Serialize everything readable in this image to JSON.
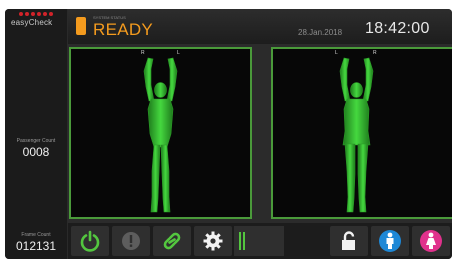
{
  "app": {
    "logo_text": "easyCheck",
    "status_small": "SYSTEM STATUS",
    "status": "READY",
    "date": "28.Jan.2018",
    "time": "18:42:00"
  },
  "counters": {
    "passenger_label": "Passenger Count",
    "passenger_value": "0008",
    "frame_label": "Frame Count",
    "frame_value": "012131"
  },
  "scans": {
    "front": {
      "marker_left": "R",
      "marker_right": "L"
    },
    "back": {
      "marker_left": "L",
      "marker_right": "R"
    }
  },
  "toolbar": {
    "buttons": [
      "power-icon",
      "alert-icon",
      "link-icon",
      "gear-icon",
      "level-indicator",
      "unlock-icon",
      "male-icon",
      "female-icon"
    ]
  },
  "colors": {
    "accent_orange": "#f49b1e",
    "scan_green": "#3fd13a",
    "border_green": "#4a9a3a",
    "male_blue": "#1e88d6",
    "female_magenta": "#e0318c",
    "logo_red": "#d2232a"
  }
}
